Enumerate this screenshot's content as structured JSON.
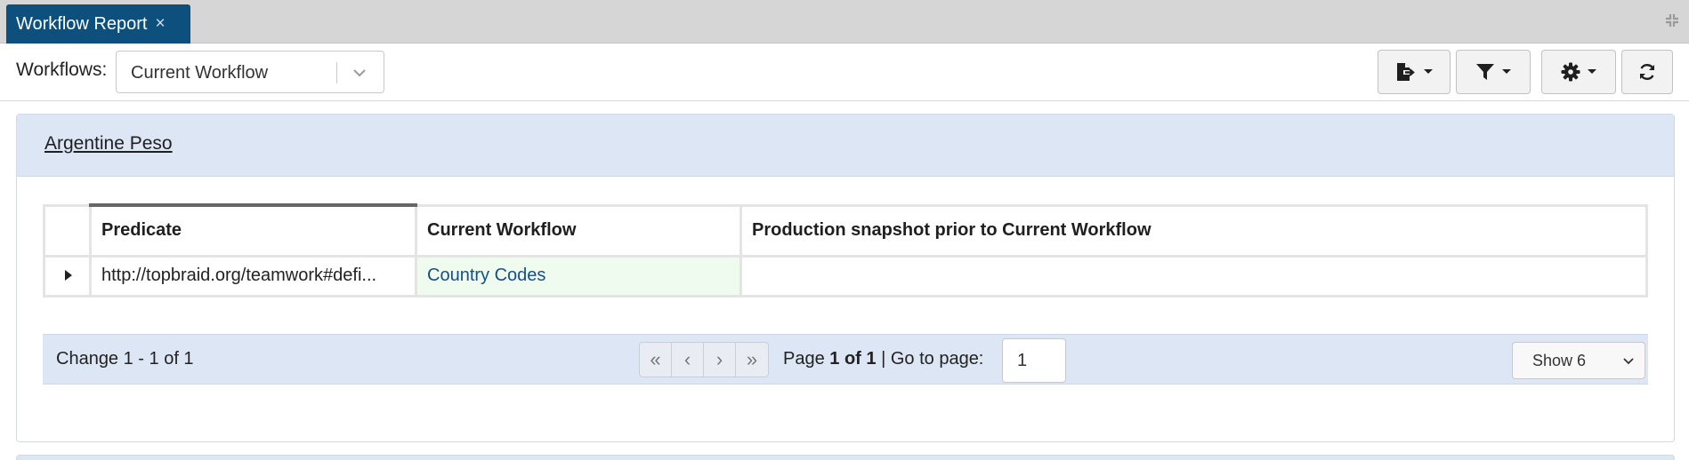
{
  "tab": {
    "title": "Workflow Report",
    "close_glyph": "×"
  },
  "toolbar": {
    "workflows_label": "Workflows:",
    "workflow_selected": "Current Workflow",
    "buttons": [
      {
        "icon": "export-file-icon",
        "has_dropdown": true
      },
      {
        "icon": "filter-icon",
        "has_dropdown": true
      },
      {
        "icon": "gear-icon",
        "has_dropdown": true
      },
      {
        "icon": "refresh-icon",
        "has_dropdown": false
      }
    ]
  },
  "panel": {
    "title": "Argentine Peso",
    "table": {
      "columns": [
        "Predicate",
        "Current Workflow",
        "Production snapshot prior to Current Workflow"
      ],
      "rows": [
        {
          "predicate": "http://topbraid.org/teamwork#defi...",
          "current": "Country Codes",
          "production": ""
        }
      ]
    },
    "pager": {
      "summary": "Change 1 - 1 of 1",
      "page_prefix": "Page",
      "page_value": "1 of 1",
      "goto_label": "| Go to page:",
      "goto_value": "1",
      "show_selected": "Show 6",
      "nav": [
        "«",
        "‹",
        "›",
        "»"
      ]
    }
  },
  "colors": {
    "tab_bg": "#0d4f7d",
    "panel_header_bg": "#dde6f4",
    "current_cell_bg": "#effbef",
    "link_color": "#174f85"
  }
}
